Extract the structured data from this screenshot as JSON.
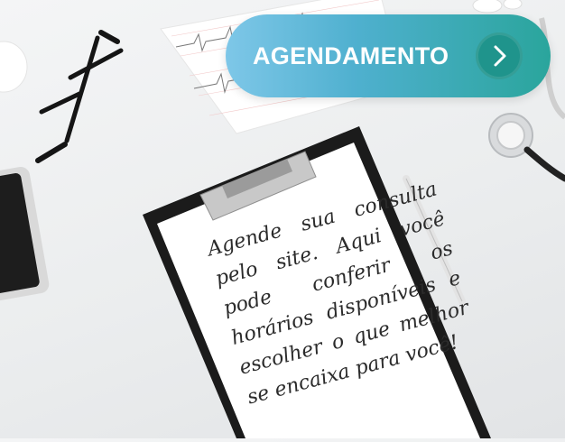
{
  "cta": {
    "label": "AGENDAMENTO",
    "icon": "chevron-right-icon",
    "colors": {
      "gradient_start": "#7ec7e8",
      "gradient_end": "#2aa59c",
      "arrow_circle": "#1f948c"
    }
  },
  "note": {
    "text": "Agende sua consulta pelo site. Aqui você pode conferir os horários disponíveis e escolher o que melhor se encaixa para você!"
  }
}
